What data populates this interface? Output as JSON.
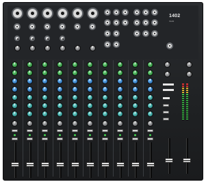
{
  "brand": {
    "logo": "1402",
    "logo_sub": "VLZ4"
  },
  "channels": {
    "count": 10,
    "mic_inputs": 6,
    "knob_colors": {
      "gain": "#2f8c3d",
      "eq": "#2a6fb3",
      "aux": "#2e8f8b",
      "pan": "#6d6f72"
    },
    "fader_level": 0.35
  },
  "colors": {
    "body": "#232528",
    "accent_led": "#43d14f",
    "meter_red": "#ff3b3b",
    "meter_yellow": "#f2c63a",
    "meter_green": "#43d14f"
  },
  "master": {
    "left_fader_level": 0.35,
    "right_fader_level": 0.35
  }
}
